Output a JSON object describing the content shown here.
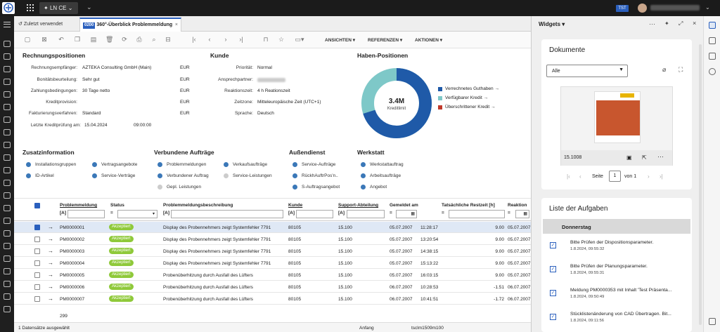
{
  "topbar": {
    "env": "LN CE",
    "badge": "TST"
  },
  "tabs": {
    "recent": "Zuletzt verwendet",
    "active_badge": "0200",
    "active": "360°-Überblick Problemmeldung",
    "close": "×"
  },
  "toolbar": {
    "views": "ANSICHTEN",
    "refs": "REFERENZEN",
    "actions": "AKTIONEN"
  },
  "rechnung": {
    "title": "Rechnungspositionen",
    "rows": [
      {
        "label": "Rechnungsempfänger:",
        "value": "AZTEKA Consulting GmbH (Main)",
        "cur": "EUR"
      },
      {
        "label": "Bonitätsbeurteilung:",
        "value": "Sehr gut",
        "cur": "EUR"
      },
      {
        "label": "Zahlungsbedingungen:",
        "value": "30 Tage netto",
        "cur": "EUR"
      },
      {
        "label": "Kreditprovision:",
        "value": "",
        "cur": "EUR"
      },
      {
        "label": "Fakturierungsverfahren:",
        "value": "Standard",
        "cur": "EUR"
      }
    ],
    "last_label": "Letzte Kreditprüfung am:",
    "last_date": "15.04.2024",
    "last_time": "09:00:00"
  },
  "kunde": {
    "title": "Kunde",
    "rows": [
      {
        "label": "Priorität:",
        "value": "Normal"
      },
      {
        "label": "Ansprechpartner:",
        "value": ""
      },
      {
        "label": "Reaktionszeit:",
        "value": "4 h Reationszeit"
      },
      {
        "label": "Zeitzone:",
        "value": "Mitteleuropäische Zeit (UTC+1)"
      },
      {
        "label": "Sprache:",
        "value": "Deutsch"
      }
    ]
  },
  "haben": {
    "title": "Haben-Positionen",
    "center_value": "3.4M",
    "center_label": "Kreditlimit",
    "legend": [
      {
        "label": "Verrechnetes Guthaben",
        "color": "#1f5aa8"
      },
      {
        "label": "Verfügbarer Kredit",
        "color": "#7ec8c8"
      },
      {
        "label": "Überschrittener Kredit",
        "color": "#c0392b"
      }
    ]
  },
  "chart_data": {
    "type": "pie",
    "title": "Haben-Positionen",
    "center_text": "3.4M Kreditlimit",
    "categories": [
      "Verrechnetes Guthaben",
      "Verfügbarer Kredit",
      "Überschrittener Kredit"
    ],
    "values": [
      70,
      30,
      0
    ]
  },
  "zusatz": {
    "title": "Zusatzinformation",
    "items": [
      "Installationsgruppen",
      "Vertragsangebote",
      "ID-Artikel",
      "Service-Verträge"
    ]
  },
  "verbunden": {
    "title": "Verbundene Aufträge",
    "items": [
      "Problemmeldungen",
      "Verkaufsaufträge",
      "Verbundener Auftrag",
      "Service-Leistungen",
      "Gepl. Leistungen"
    ]
  },
  "aussendienst": {
    "title": "Außendienst",
    "items": [
      "Service-Aufträge",
      "RückhAuftrPos'n..",
      "S-Auftragsangebot"
    ]
  },
  "werkstatt": {
    "title": "Werkstatt",
    "items": [
      "Werkstattauftrag",
      "Arbeitsaufträge",
      "Angebot"
    ]
  },
  "table": {
    "headers": [
      "Problemmeldung",
      "Status",
      "Problemmeldungsbeschreibung",
      "Kunde",
      "Support-Abteilung",
      "Gemeldet am",
      "Tatsächliche Restzeit [h]",
      "Reaktion"
    ],
    "filter_a": "[A]",
    "rows": [
      {
        "id": "PM0000001",
        "status": "Akzeptiert",
        "desc": "Display des Probennehmers zeigt Systemfehler 7791",
        "kunde": "80105",
        "abt": "15.100",
        "date": "05.07.2007",
        "time": "11:28:17",
        "rest": "9.00",
        "reak": "05.07.2007"
      },
      {
        "id": "PM0000002",
        "status": "Akzeptiert",
        "desc": "Display des Probennehmers zeigt Systemfehler 7791",
        "kunde": "80105",
        "abt": "15.100",
        "date": "05.07.2007",
        "time": "13:20:54",
        "rest": "9.00",
        "reak": "05.07.2007"
      },
      {
        "id": "PM0000003",
        "status": "Akzeptiert",
        "desc": "Display des Probennehmers zeigt Systemfehler 7791",
        "kunde": "80105",
        "abt": "15.100",
        "date": "05.07.2007",
        "time": "14:38:15",
        "rest": "9.00",
        "reak": "05.07.2007"
      },
      {
        "id": "PM0000004",
        "status": "Akzeptiert",
        "desc": "Display des Probennehmers zeigt Systemfehler 7791",
        "kunde": "80105",
        "abt": "15.100",
        "date": "05.07.2007",
        "time": "15:13:22",
        "rest": "9.00",
        "reak": "05.07.2007"
      },
      {
        "id": "PM0000005",
        "status": "Akzeptiert",
        "desc": "Probenüberhitzung durch Ausfall des Lüfters",
        "kunde": "80105",
        "abt": "15.100",
        "date": "05.07.2007",
        "time": "16:03:15",
        "rest": "9.00",
        "reak": "05.07.2007"
      },
      {
        "id": "PM0000006",
        "status": "Akzeptiert",
        "desc": "Probenüberhitzung durch Ausfall des Lüfters",
        "kunde": "80105",
        "abt": "15.100",
        "date": "06.07.2007",
        "time": "10:28:53",
        "rest": "-1.51",
        "reak": "06.07.2007"
      },
      {
        "id": "PM0000007",
        "status": "Akzeptiert",
        "desc": "Probenüberhitzung durch Ausfall des Lüfters",
        "kunde": "80105",
        "abt": "15.100",
        "date": "06.07.2007",
        "time": "10:41:51",
        "rest": "-1.72",
        "reak": "06.07.2007"
      }
    ],
    "total": "299"
  },
  "footer": {
    "selected": "1 Datensätze ausgewählt",
    "start": "Anfang",
    "session": "tsclm1509m100"
  },
  "widgets": {
    "title": "Widgets",
    "docs": {
      "title": "Dokumente",
      "filter": "Alle",
      "doc_id": "15.1008",
      "page_label": "Seite",
      "page": "1",
      "of": "von 1"
    },
    "tasks": {
      "title": "Liste der Aufgaben",
      "group": "Donnerstag",
      "items": [
        {
          "title": "Bitte Prüfen der Dispositionsparameter.",
          "date": "1.8.2024, 09:55:32"
        },
        {
          "title": "Bitte Prüfen der Planungsparameter.",
          "date": "1.8.2024, 09:55:31"
        },
        {
          "title": "Meldung PM0000353 mit Inhalt 'Test Präsenta...",
          "date": "1.8.2024, 09:50:49"
        },
        {
          "title": "Stücklistenänderung von CAD Übertragen. Bit...",
          "date": "1.8.2024, 09:11:56"
        }
      ]
    }
  }
}
